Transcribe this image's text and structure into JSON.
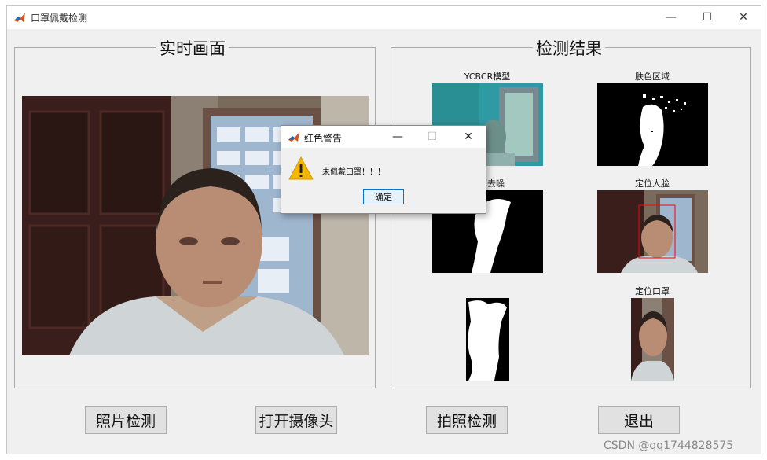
{
  "window": {
    "title": "口罩佩戴检测",
    "controls": {
      "minimize": "—",
      "maximize": "☐",
      "close": "✕"
    }
  },
  "left_panel": {
    "title": "实时画面"
  },
  "right_panel": {
    "title": "检测结果",
    "captions": {
      "ycbcr": "YCBCR模型",
      "skin": "肤色区域",
      "denoise": "运算去噪",
      "face": "定位人脸",
      "mask": "定位口罩"
    }
  },
  "buttons": {
    "photo_detect": "照片检测",
    "open_camera": "打开摄像头",
    "snap_detect": "拍照检测",
    "exit": "退出"
  },
  "dialog": {
    "title": "红色警告",
    "message": "未佩戴口罩！！！",
    "ok_label": "确定",
    "controls": {
      "minimize": "—",
      "maximize": "☐",
      "close": "✕"
    }
  },
  "watermark": "CSDN @qq1744828575",
  "colors": {
    "warning": "#f5b700",
    "face_box": "#ff0000",
    "ok_border": "#0078d7"
  }
}
